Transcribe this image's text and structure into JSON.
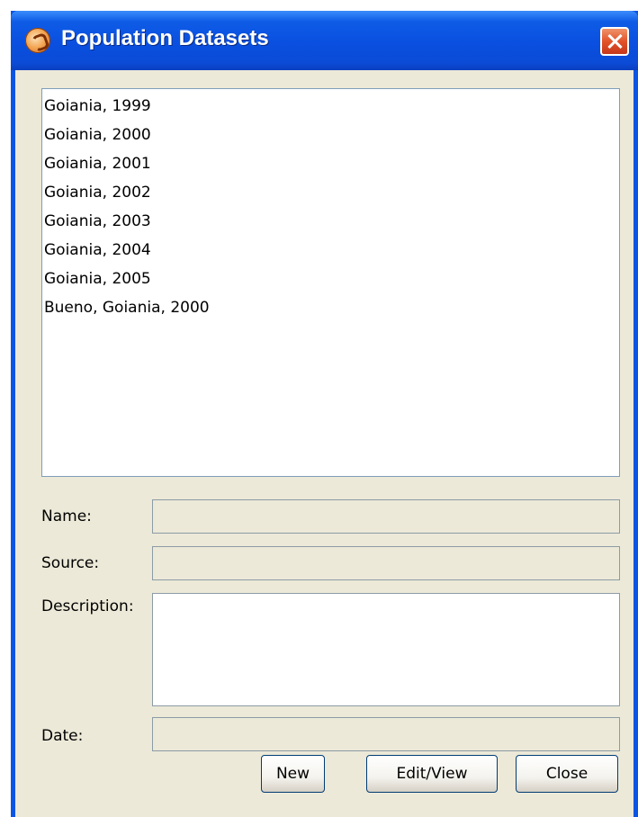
{
  "window": {
    "title": "Population Datasets",
    "close_icon": "close-icon",
    "app_icon": "terraview-app-icon"
  },
  "datasets": [
    "Goiania, 1999",
    "Goiania, 2000",
    "Goiania, 2001",
    "Goiania, 2002",
    "Goiania, 2003",
    "Goiania, 2004",
    "Goiania, 2005",
    "Bueno, Goiania, 2000"
  ],
  "form": {
    "name_label": "Name:",
    "name_value": "",
    "source_label": "Source:",
    "source_value": "",
    "description_label": "Description:",
    "description_value": "",
    "date_label": "Date:",
    "date_value": ""
  },
  "buttons": {
    "new_label": "New",
    "edit_view_label": "Edit/View",
    "close_label": "Close"
  },
  "colors": {
    "titlebar": "#0a55e3",
    "dialog_background": "#ece9d8",
    "close_button": "#e2532a"
  }
}
